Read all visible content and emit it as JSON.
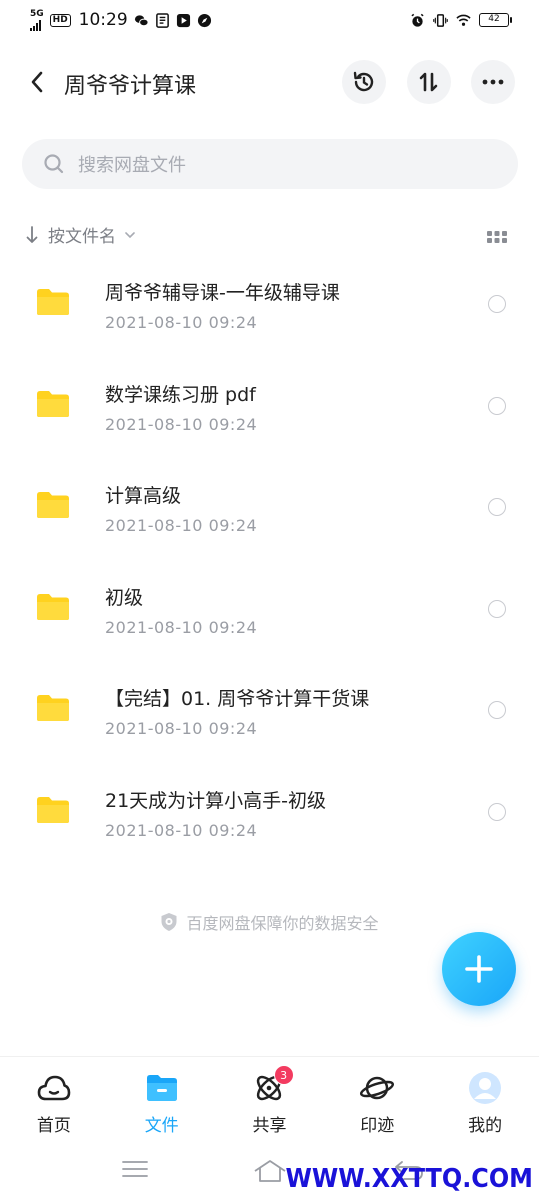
{
  "status_bar": {
    "network": "5G",
    "hd": "HD",
    "time": "10:29",
    "battery": "42"
  },
  "header": {
    "title": "周爷爷计算课",
    "icons": [
      "back-icon",
      "history-icon",
      "sort-transfer-icon",
      "more-icon"
    ]
  },
  "search": {
    "placeholder": "搜索网盘文件"
  },
  "sort": {
    "label": "按文件名"
  },
  "files": [
    {
      "name": "周爷爷辅导课-一年级辅导课",
      "date": "2021-08-10  09:24"
    },
    {
      "name": "数学课练习册 pdf",
      "date": "2021-08-10  09:24"
    },
    {
      "name": "计算高级",
      "date": "2021-08-10  09:24"
    },
    {
      "name": "初级",
      "date": "2021-08-10  09:24"
    },
    {
      "name": "【完结】01. 周爷爷计算干货课",
      "date": "2021-08-10  09:24"
    },
    {
      "name": "21天成为计算小高手-初级",
      "date": "2021-08-10  09:24"
    }
  ],
  "security_note": "百度网盘保障你的数据安全",
  "colors": {
    "accent": "#1aa6f8",
    "folder": "#ffd21f",
    "badge": "#f33b60"
  },
  "bottom_nav": {
    "items": [
      {
        "label": "首页",
        "icon": "home-cloud-icon"
      },
      {
        "label": "文件",
        "icon": "folder-icon",
        "active": true
      },
      {
        "label": "共享",
        "icon": "share-atom-icon",
        "badge": "3"
      },
      {
        "label": "印迹",
        "icon": "planet-icon"
      },
      {
        "label": "我的",
        "icon": "avatar-icon"
      }
    ]
  },
  "watermark": "WWW.XXTTQ.COM"
}
